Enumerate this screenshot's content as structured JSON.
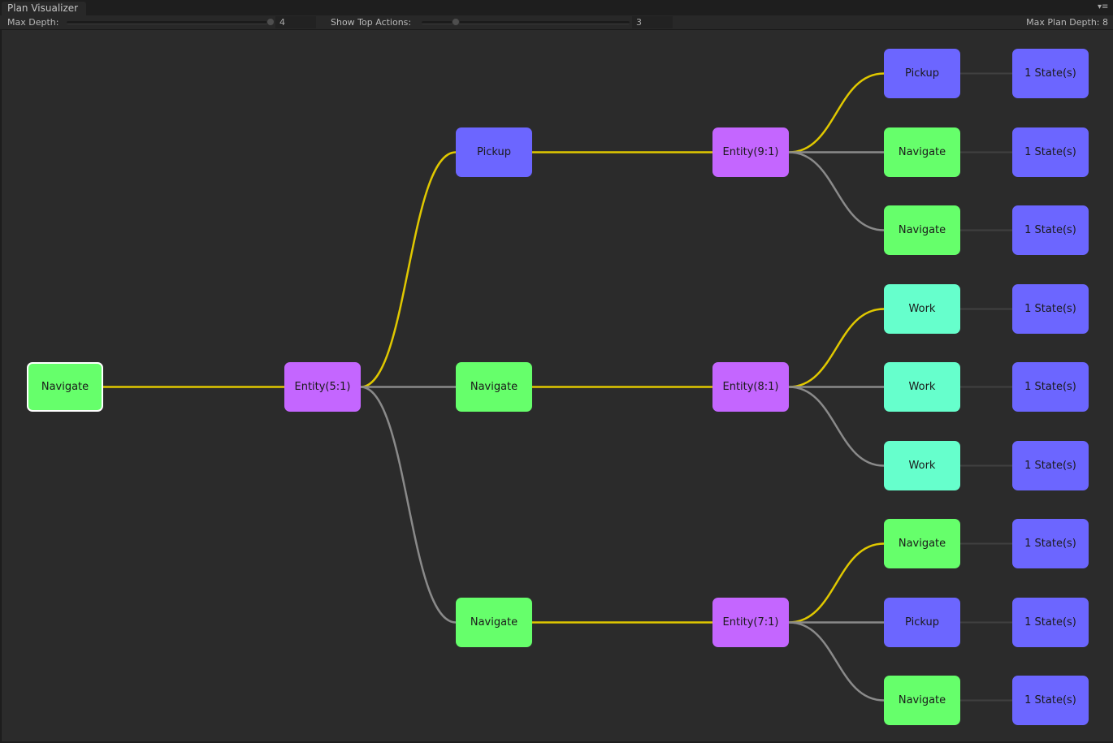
{
  "window": {
    "tab_title": "Plan Visualizer",
    "menu_icon": "context-menu-icon"
  },
  "toolbar": {
    "max_depth_label": "Max Depth:",
    "max_depth_value": "4",
    "max_depth_fraction": 1.0,
    "show_top_actions_label": "Show Top Actions:",
    "show_top_actions_value": "3",
    "show_top_actions_fraction": 0.15,
    "max_plan_depth_label": "Max Plan Depth: 8"
  },
  "colors": {
    "action_green": "#66ff6b",
    "action_blue": "#6c66ff",
    "action_teal": "#66ffcc",
    "entity_purple": "#c466ff",
    "state_blue": "#6c66ff",
    "edge_selected": "#e0c800",
    "edge_default": "#8a8a8a",
    "edge_state": "#404040"
  },
  "graph": {
    "nodes": [
      {
        "id": "n0",
        "label": "Navigate",
        "kind": "action_green",
        "col": 0,
        "row": 4,
        "selected": true
      },
      {
        "id": "e51",
        "label": "Entity(5:1)",
        "kind": "entity_purple",
        "col": 1,
        "row": 4
      },
      {
        "id": "a1",
        "label": "Pickup",
        "kind": "action_blue",
        "col": 2,
        "row": 1
      },
      {
        "id": "a2",
        "label": "Navigate",
        "kind": "action_green",
        "col": 2,
        "row": 4
      },
      {
        "id": "a3",
        "label": "Navigate",
        "kind": "action_green",
        "col": 2,
        "row": 7
      },
      {
        "id": "e91",
        "label": "Entity(9:1)",
        "kind": "entity_purple",
        "col": 3,
        "row": 1
      },
      {
        "id": "e81",
        "label": "Entity(8:1)",
        "kind": "entity_purple",
        "col": 3,
        "row": 4
      },
      {
        "id": "e71",
        "label": "Entity(7:1)",
        "kind": "entity_purple",
        "col": 3,
        "row": 7
      },
      {
        "id": "b0",
        "label": "Pickup",
        "kind": "action_blue",
        "col": 4,
        "row": 0
      },
      {
        "id": "b1",
        "label": "Navigate",
        "kind": "action_green",
        "col": 4,
        "row": 1
      },
      {
        "id": "b2",
        "label": "Navigate",
        "kind": "action_green",
        "col": 4,
        "row": 2
      },
      {
        "id": "b3",
        "label": "Work",
        "kind": "action_teal",
        "col": 4,
        "row": 3
      },
      {
        "id": "b4",
        "label": "Work",
        "kind": "action_teal",
        "col": 4,
        "row": 4
      },
      {
        "id": "b5",
        "label": "Work",
        "kind": "action_teal",
        "col": 4,
        "row": 5
      },
      {
        "id": "b6",
        "label": "Navigate",
        "kind": "action_green",
        "col": 4,
        "row": 6
      },
      {
        "id": "b7",
        "label": "Pickup",
        "kind": "action_blue",
        "col": 4,
        "row": 7
      },
      {
        "id": "b8",
        "label": "Navigate",
        "kind": "action_green",
        "col": 4,
        "row": 8
      },
      {
        "id": "s0",
        "label": "1 State(s)",
        "kind": "state_blue",
        "col": 5,
        "row": 0
      },
      {
        "id": "s1",
        "label": "1 State(s)",
        "kind": "state_blue",
        "col": 5,
        "row": 1
      },
      {
        "id": "s2",
        "label": "1 State(s)",
        "kind": "state_blue",
        "col": 5,
        "row": 2
      },
      {
        "id": "s3",
        "label": "1 State(s)",
        "kind": "state_blue",
        "col": 5,
        "row": 3
      },
      {
        "id": "s4",
        "label": "1 State(s)",
        "kind": "state_blue",
        "col": 5,
        "row": 4
      },
      {
        "id": "s5",
        "label": "1 State(s)",
        "kind": "state_blue",
        "col": 5,
        "row": 5
      },
      {
        "id": "s6",
        "label": "1 State(s)",
        "kind": "state_blue",
        "col": 5,
        "row": 6
      },
      {
        "id": "s7",
        "label": "1 State(s)",
        "kind": "state_blue",
        "col": 5,
        "row": 7
      },
      {
        "id": "s8",
        "label": "1 State(s)",
        "kind": "state_blue",
        "col": 5,
        "row": 8
      }
    ],
    "edges": [
      {
        "from": "n0",
        "to": "e51",
        "style": "edge_selected"
      },
      {
        "from": "e51",
        "to": "a1",
        "style": "edge_selected"
      },
      {
        "from": "e51",
        "to": "a2",
        "style": "edge_default"
      },
      {
        "from": "e51",
        "to": "a3",
        "style": "edge_default"
      },
      {
        "from": "a1",
        "to": "e91",
        "style": "edge_selected"
      },
      {
        "from": "a2",
        "to": "e81",
        "style": "edge_selected"
      },
      {
        "from": "a3",
        "to": "e71",
        "style": "edge_selected"
      },
      {
        "from": "e91",
        "to": "b0",
        "style": "edge_selected"
      },
      {
        "from": "e91",
        "to": "b1",
        "style": "edge_default"
      },
      {
        "from": "e91",
        "to": "b2",
        "style": "edge_default"
      },
      {
        "from": "e81",
        "to": "b3",
        "style": "edge_selected"
      },
      {
        "from": "e81",
        "to": "b4",
        "style": "edge_default"
      },
      {
        "from": "e81",
        "to": "b5",
        "style": "edge_default"
      },
      {
        "from": "e71",
        "to": "b6",
        "style": "edge_selected"
      },
      {
        "from": "e71",
        "to": "b7",
        "style": "edge_default"
      },
      {
        "from": "e71",
        "to": "b8",
        "style": "edge_default"
      },
      {
        "from": "b0",
        "to": "s0",
        "style": "edge_state"
      },
      {
        "from": "b1",
        "to": "s1",
        "style": "edge_state"
      },
      {
        "from": "b2",
        "to": "s2",
        "style": "edge_state"
      },
      {
        "from": "b3",
        "to": "s3",
        "style": "edge_state"
      },
      {
        "from": "b4",
        "to": "s4",
        "style": "edge_state"
      },
      {
        "from": "b5",
        "to": "s5",
        "style": "edge_state"
      },
      {
        "from": "b6",
        "to": "s6",
        "style": "edge_state"
      },
      {
        "from": "b7",
        "to": "s7",
        "style": "edge_state"
      },
      {
        "from": "b8",
        "to": "s8",
        "style": "edge_state"
      }
    ]
  }
}
